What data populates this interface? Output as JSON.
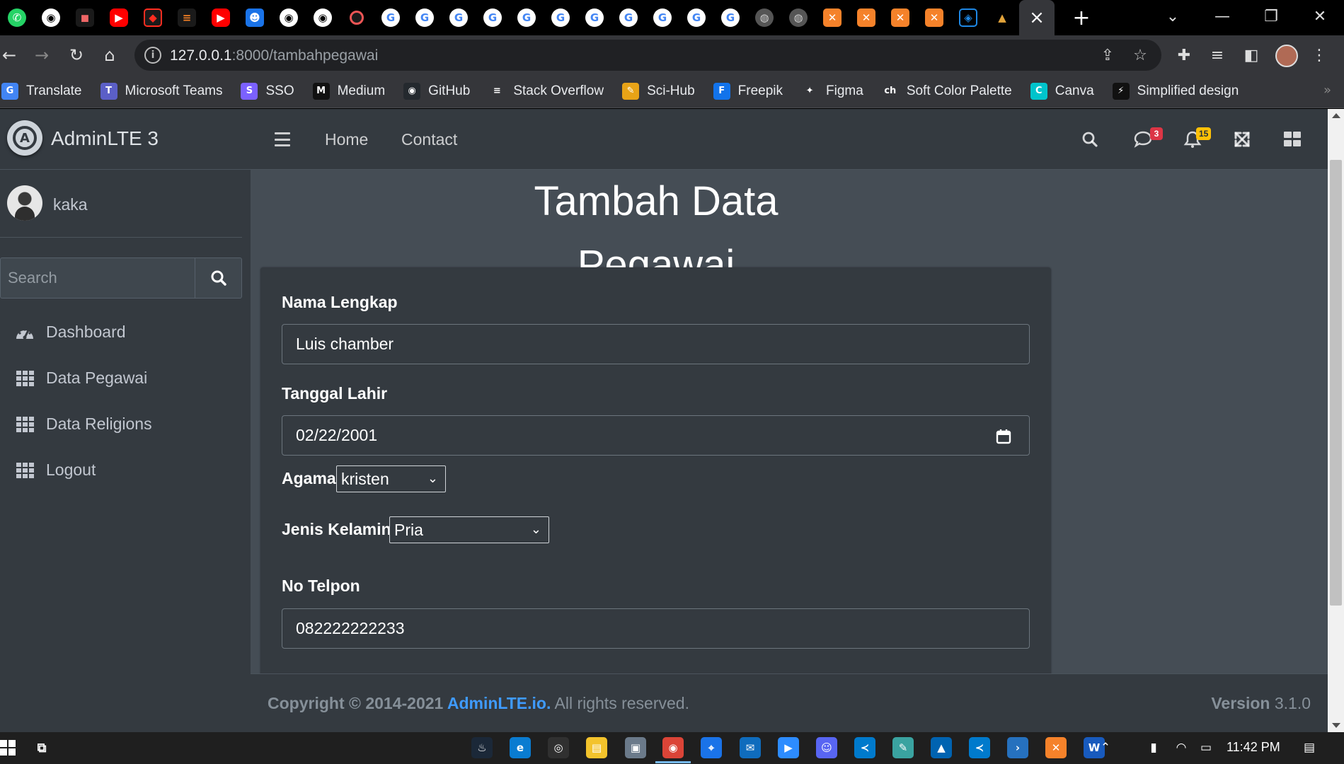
{
  "browser": {
    "tabs": [
      {
        "icon": "whatsapp-icon",
        "cls": "fav-wa",
        "glyph": "✆"
      },
      {
        "icon": "github-icon",
        "cls": "fav-gh",
        "glyph": "◉"
      },
      {
        "icon": "profile-photo-icon",
        "cls": "fav-dc",
        "glyph": "◼"
      },
      {
        "icon": "youtube-icon",
        "cls": "fav-yt",
        "glyph": "▶"
      },
      {
        "icon": "laravel-icon",
        "cls": "fav-lar",
        "glyph": "◆"
      },
      {
        "icon": "stackoverflow-icon",
        "cls": "fav-so",
        "glyph": "≡"
      },
      {
        "icon": "youtube-icon",
        "cls": "fav-yt",
        "glyph": "▶"
      },
      {
        "icon": "contacts-icon",
        "cls": "fav-pp",
        "glyph": "☻"
      },
      {
        "icon": "github-icon",
        "cls": "fav-gh",
        "glyph": "◉"
      },
      {
        "icon": "github-icon",
        "cls": "fav-gh",
        "glyph": "◉"
      },
      {
        "icon": "record-icon",
        "cls": "fav-rec",
        "glyph": ""
      },
      {
        "icon": "google-icon",
        "cls": "fav-g",
        "glyph": "G"
      },
      {
        "icon": "google-icon",
        "cls": "fav-g",
        "glyph": "G"
      },
      {
        "icon": "google-icon",
        "cls": "fav-g",
        "glyph": "G"
      },
      {
        "icon": "google-icon",
        "cls": "fav-g",
        "glyph": "G"
      },
      {
        "icon": "google-icon",
        "cls": "fav-g",
        "glyph": "G"
      },
      {
        "icon": "google-icon",
        "cls": "fav-g",
        "glyph": "G"
      },
      {
        "icon": "google-icon",
        "cls": "fav-g",
        "glyph": "G"
      },
      {
        "icon": "google-icon",
        "cls": "fav-g",
        "glyph": "G"
      },
      {
        "icon": "google-icon",
        "cls": "fav-g",
        "glyph": "G"
      },
      {
        "icon": "google-icon",
        "cls": "fav-g",
        "glyph": "G"
      },
      {
        "icon": "google-icon",
        "cls": "fav-g",
        "glyph": "G"
      },
      {
        "icon": "globe-icon",
        "cls": "fav-globe",
        "glyph": "◍"
      },
      {
        "icon": "globe-icon",
        "cls": "fav-globe",
        "glyph": "◍"
      },
      {
        "icon": "xampp-icon",
        "cls": "fav-x",
        "glyph": "✕"
      },
      {
        "icon": "xampp-icon",
        "cls": "fav-x",
        "glyph": "✕"
      },
      {
        "icon": "xampp-icon",
        "cls": "fav-x",
        "glyph": "✕"
      },
      {
        "icon": "xampp-icon",
        "cls": "fav-x",
        "glyph": "✕"
      },
      {
        "icon": "shield-logo-icon",
        "cls": "fav-b",
        "glyph": "◈"
      },
      {
        "icon": "pinterest-like-icon",
        "cls": "fav-pn",
        "glyph": "▲"
      }
    ],
    "url_host": "127.0.0.1",
    "url_path": ":8000/tambahpegawai",
    "bookmarks": [
      {
        "label": "Translate",
        "icon": "google-translate-icon",
        "color": "#4285f4",
        "glyph": "G"
      },
      {
        "label": "Microsoft Teams",
        "icon": "teams-icon",
        "color": "#5b5fc7",
        "glyph": "T"
      },
      {
        "label": "SSO",
        "icon": "sso-icon",
        "color": "#7b61ff",
        "glyph": "S"
      },
      {
        "label": "Medium",
        "icon": "medium-icon",
        "color": "#111111",
        "glyph": "M"
      },
      {
        "label": "GitHub",
        "icon": "github-icon",
        "color": "#24292e",
        "glyph": "◉"
      },
      {
        "label": "Stack Overflow",
        "icon": "stackoverflow-icon",
        "color": "#35363a",
        "glyph": "≡"
      },
      {
        "label": "Sci-Hub",
        "icon": "scihub-icon",
        "color": "#e8a317",
        "glyph": "✎"
      },
      {
        "label": "Freepik",
        "icon": "freepik-icon",
        "color": "#1273eb",
        "glyph": "F"
      },
      {
        "label": "Figma",
        "icon": "figma-icon",
        "color": "#35363a",
        "glyph": "✦"
      },
      {
        "label": "Soft Color Palette",
        "icon": "palette-icon",
        "color": "#35363a",
        "glyph": "ch"
      },
      {
        "label": "Canva",
        "icon": "canva-icon",
        "color": "#00c4cc",
        "glyph": "C"
      },
      {
        "label": "Simplified design",
        "icon": "simplified-icon",
        "color": "#111111",
        "glyph": "⚡"
      }
    ]
  },
  "app": {
    "brand": "AdminLTE 3",
    "user_name": "kaka",
    "search_placeholder": "Search",
    "nav": [
      {
        "label": "Dashboard",
        "icon": "dashboard-gauge-icon"
      },
      {
        "label": "Data Pegawai",
        "icon": "grid-icon"
      },
      {
        "label": "Data Religions",
        "icon": "grid-icon"
      },
      {
        "label": "Logout",
        "icon": "grid-icon"
      }
    ],
    "topnav": {
      "home": "Home",
      "contact": "Contact",
      "messages_count": "3",
      "notifications_count": "15"
    },
    "page_title": "Tambah Data Pegawai",
    "form": {
      "nama_label": "Nama Lengkap",
      "nama_value": "Luis chamber",
      "tanggal_label": "Tanggal Lahir",
      "tanggal_value": "02/22/2001",
      "agama_label": "Agama",
      "agama_value": "kristen",
      "jk_label": "Jenis Kelamin",
      "jk_value": "Pria",
      "telpon_label": "No Telpon",
      "telpon_value": "082222222233"
    },
    "footer": {
      "copyright": "Copyright © 2014-2021 ",
      "link": "AdminLTE.io.",
      "rights": " All rights reserved.",
      "version_label": "Version",
      "version_value": " 3.1.0"
    },
    "colors": {
      "badge_messages": "#dc3545",
      "badge_notifications": "#ffc107",
      "link": "#3f9bff"
    }
  },
  "taskbar": {
    "clock": "11:42 PM",
    "apps": [
      {
        "icon": "steam-icon",
        "color": "#1b2838",
        "glyph": "♨"
      },
      {
        "icon": "edge-icon",
        "color": "#0a7cd1",
        "glyph": "e"
      },
      {
        "icon": "obs-icon",
        "color": "#303030",
        "glyph": "◎"
      },
      {
        "icon": "file-explorer-icon",
        "color": "#f3c32c",
        "glyph": "▤"
      },
      {
        "icon": "disk-icon",
        "color": "#6b7a8a",
        "glyph": "▣"
      },
      {
        "icon": "chrome-icon",
        "color": "#db4437",
        "glyph": "◉"
      },
      {
        "icon": "maps-icon",
        "color": "#1a73e8",
        "glyph": "⌖"
      },
      {
        "icon": "mail-icon",
        "color": "#0f6cbd",
        "glyph": "✉"
      },
      {
        "icon": "zoom-icon",
        "color": "#2d8cff",
        "glyph": "▶"
      },
      {
        "icon": "discord-icon",
        "color": "#5865f2",
        "glyph": "☺"
      },
      {
        "icon": "vscode-icon",
        "color": "#007acc",
        "glyph": "≺"
      },
      {
        "icon": "notes-icon",
        "color": "#3aa3a0",
        "glyph": "✎"
      },
      {
        "icon": "photos-icon",
        "color": "#0063b1",
        "glyph": "▲"
      },
      {
        "icon": "vscode-icon",
        "color": "#007acc",
        "glyph": "≺"
      },
      {
        "icon": "powershell-icon",
        "color": "#2671be",
        "glyph": "›"
      },
      {
        "icon": "xampp-icon",
        "color": "#f5822a",
        "glyph": "✕"
      },
      {
        "icon": "word-icon",
        "color": "#185abd",
        "glyph": "W"
      }
    ]
  }
}
